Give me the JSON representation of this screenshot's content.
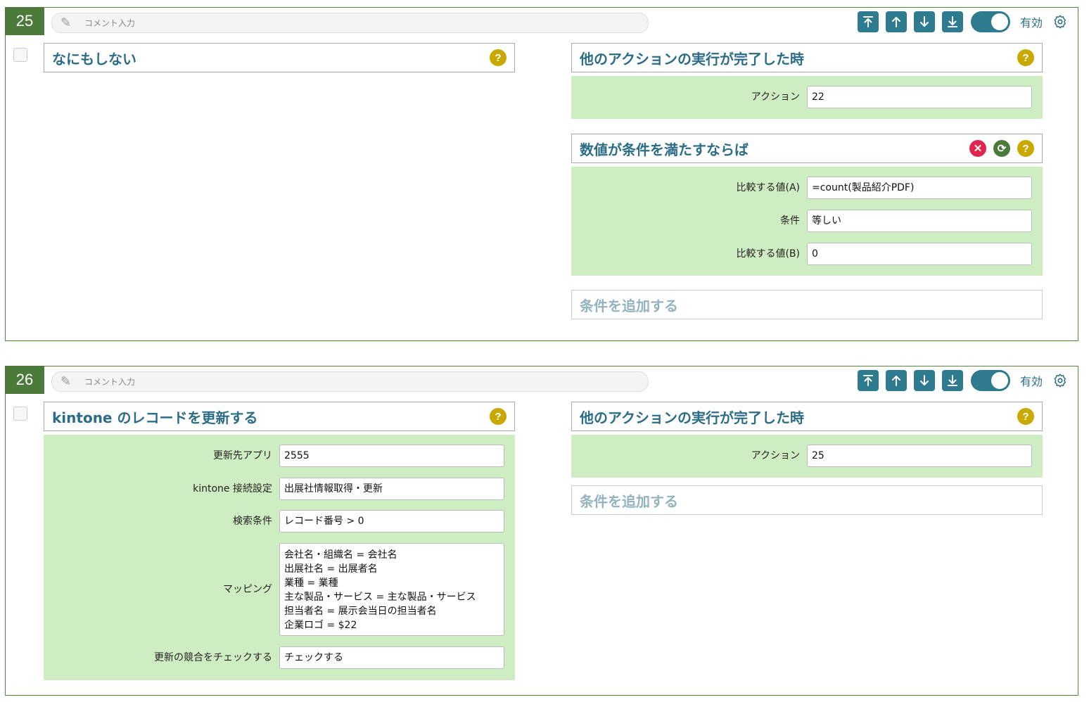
{
  "cards": [
    {
      "number": "25",
      "comment_placeholder": "コメント入力",
      "enabled_label": "有効",
      "action": {
        "title": "なにもしない"
      },
      "trigger": {
        "title": "他のアクションの実行が完了した時",
        "fields": [
          {
            "label": "アクション",
            "value": "22"
          }
        ]
      },
      "condition": {
        "title": "数値が条件を満たすならば",
        "fields": [
          {
            "label": "比較する値(A)",
            "value": "=count(製品紹介PDF)"
          },
          {
            "label": "条件",
            "value": "等しい"
          },
          {
            "label": "比較する値(B)",
            "value": "0"
          }
        ]
      },
      "add_condition": "条件を追加する"
    },
    {
      "number": "26",
      "comment_placeholder": "コメント入力",
      "enabled_label": "有効",
      "action": {
        "title": "kintone のレコードを更新する",
        "fields": [
          {
            "label": "更新先アプリ",
            "value": "2555"
          },
          {
            "label": "kintone 接続設定",
            "value": "出展社情報取得・更新"
          },
          {
            "label": "検索条件",
            "value": "レコード番号 > 0"
          },
          {
            "label": "マッピング",
            "value": "会社名・組織名 = 会社名\n出展社名 = 出展者名\n業種 = 業種\n主な製品・サービス = 主な製品・サービス\n担当者名 = 展示会当日の担当者名\n企業ロゴ = $22"
          },
          {
            "label": "更新の競合をチェックする",
            "value": "チェックする"
          }
        ]
      },
      "trigger": {
        "title": "他のアクションの実行が完了した時",
        "fields": [
          {
            "label": "アクション",
            "value": "25"
          }
        ]
      },
      "add_condition": "条件を追加する"
    }
  ],
  "icons": {
    "comment": "pencil-icon",
    "toolbar": [
      "move-top-icon",
      "move-up-icon",
      "move-down-icon",
      "move-bottom-icon"
    ],
    "settings": "gear-icon",
    "help": "help-icon",
    "delete": "delete-icon",
    "refresh": "refresh-icon"
  },
  "colors": {
    "accent": "#2e7a8f",
    "card_border": "#4f8a3f",
    "panel_bg": "#cfedc2",
    "help": "#c9a800",
    "delete": "#e0254c"
  }
}
